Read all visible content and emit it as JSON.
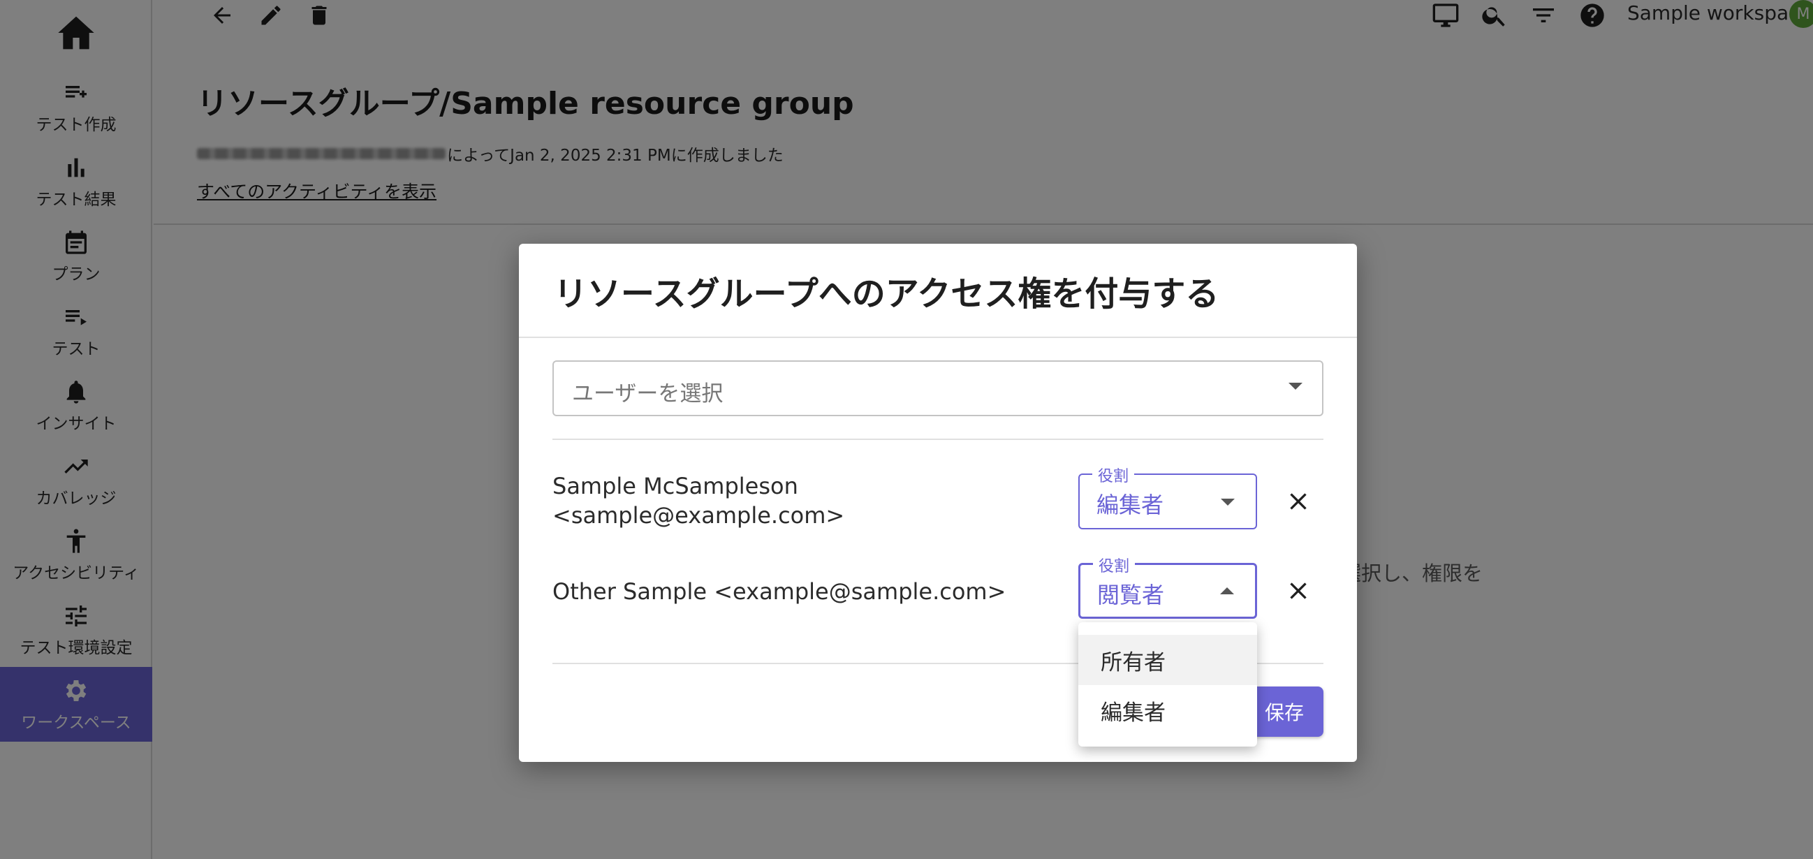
{
  "sidebar": {
    "items": [
      {
        "label": "テスト作成",
        "icon": "playlist-add-icon"
      },
      {
        "label": "テスト結果",
        "icon": "bar-chart-icon"
      },
      {
        "label": "プラン",
        "icon": "calendar-icon"
      },
      {
        "label": "テスト",
        "icon": "playlist-play-icon"
      },
      {
        "label": "インサイト",
        "icon": "bell-icon"
      },
      {
        "label": "カバレッジ",
        "icon": "trending-up-icon"
      },
      {
        "label": "アクセシビリティ",
        "icon": "accessibility-icon"
      },
      {
        "label": "テスト環境設定",
        "icon": "tune-icon"
      },
      {
        "label": "ワークスペース",
        "icon": "gear-icon"
      }
    ],
    "active_index": 8
  },
  "topbar": {
    "workspace_name": "Sample workspace",
    "avatar_initial": "M"
  },
  "page": {
    "title": "リソースグループ/Sample resource group",
    "created_suffix": "によってJan 2, 2025 2:31 PMに作成しました",
    "activity_link": "すべてのアクティビティを表示",
    "background_hint": "選択し、権限を"
  },
  "dialog": {
    "title": "リソースグループへのアクセス権を付与する",
    "user_select_placeholder": "ユーザーを選択",
    "members": [
      {
        "name_line1": "Sample McSampleson",
        "name_line2": "<sample@example.com>",
        "role_label": "役割",
        "role": "編集者"
      },
      {
        "name_line1": "Other Sample  <example@sample.com>",
        "role_label": "役割",
        "role": "閲覧者"
      }
    ],
    "save_label": "保存"
  },
  "role_menu": {
    "options": [
      "所有者",
      "編集者"
    ]
  },
  "colors": {
    "accent": "#6b64d6",
    "overlay": "rgba(0,0,0,0.5)"
  }
}
